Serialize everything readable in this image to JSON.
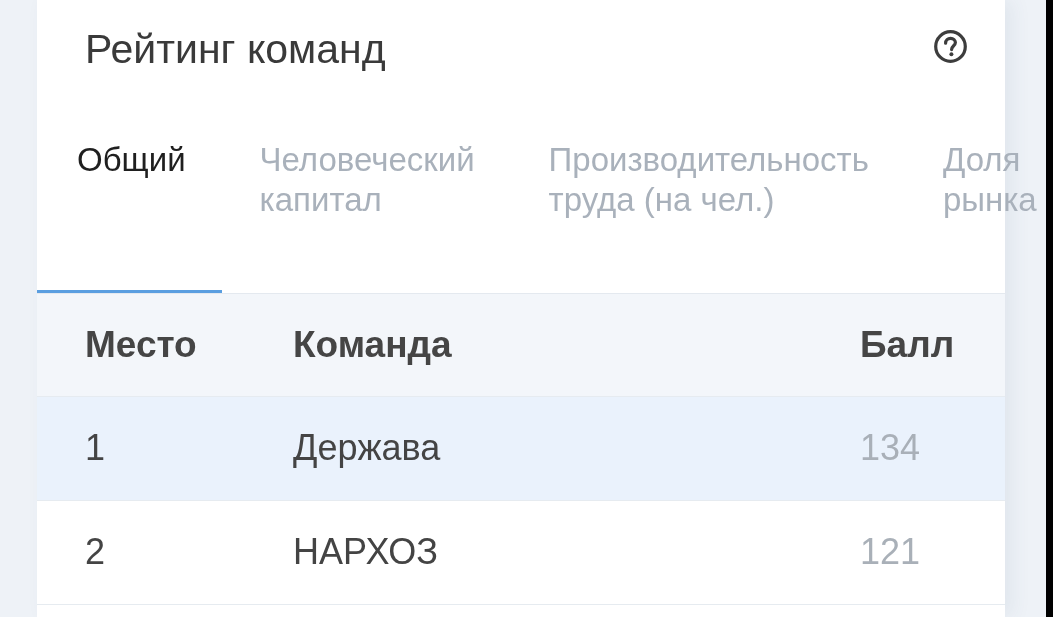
{
  "header": {
    "title": "Рейтинг команд"
  },
  "tabs": [
    {
      "label": "Общий",
      "selected": true
    },
    {
      "label": "Человеческий капитал",
      "selected": false
    },
    {
      "label": "Производительность труда (на чел.)",
      "selected": false
    },
    {
      "label": "Доля рынка",
      "selected": false
    }
  ],
  "table": {
    "columns": [
      "Место",
      "Команда",
      "Балл"
    ],
    "rows": [
      {
        "cells": [
          "1",
          "Держава",
          "134"
        ],
        "selected": true
      },
      {
        "cells": [
          "2",
          "НАРХОЗ",
          "121"
        ],
        "selected": false
      }
    ]
  }
}
